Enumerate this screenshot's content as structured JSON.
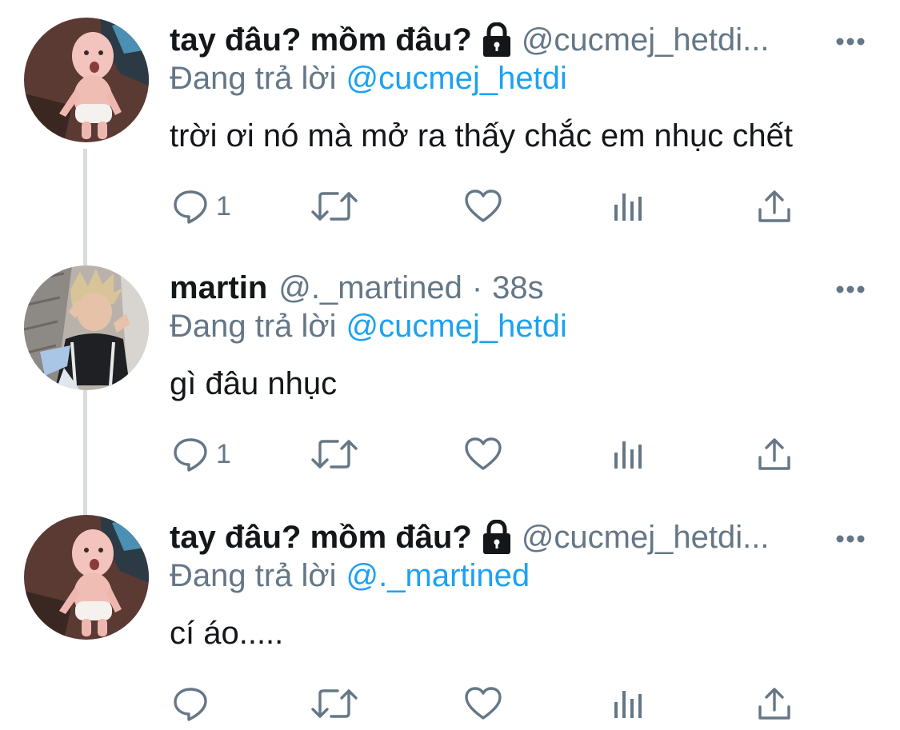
{
  "tweets": [
    {
      "display_name": "tay đâu? mồm đâu?",
      "handle": "@cucmej_hetdi...",
      "replying_label": "Đang trả lời",
      "replying_to": "@cucmej_hetdi",
      "text": "trời ơi nó mà mở ra thấy chắc em nhục chết",
      "reply_count": "1",
      "protected": true,
      "avatar": "baby-avatar"
    },
    {
      "display_name": "martin",
      "handle": "@._martined",
      "dot": "·",
      "time": "38s",
      "replying_label": "Đang trả lời",
      "replying_to": "@cucmej_hetdi",
      "text": "gì đâu nhục",
      "reply_count": "1",
      "protected": false,
      "avatar": "person-avatar"
    },
    {
      "display_name": "tay đâu? mồm đâu?",
      "handle": "@cucmej_hetdi...",
      "replying_label": "Đang trả lời",
      "replying_to": "@._martined",
      "text": "cí áo.....",
      "reply_count": "",
      "protected": true,
      "avatar": "baby-avatar"
    }
  ],
  "icons": {
    "reply": "reply-icon",
    "retweet": "retweet-icon",
    "like": "like-icon",
    "analytics": "analytics-icon",
    "share": "share-icon",
    "more": "more-icon",
    "lock": "lock-icon"
  },
  "colors": {
    "text": "#14171a",
    "secondary": "#657786",
    "link": "#1da1f2",
    "thread_line": "#d8dde1"
  }
}
